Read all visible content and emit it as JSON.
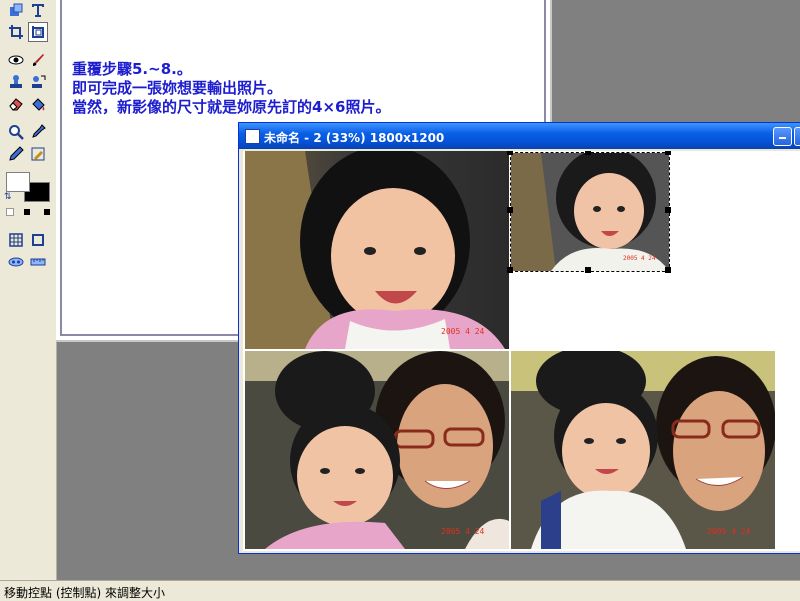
{
  "instructions": [
    "重覆步驟5.~8.。",
    "即可完成一張妳想要輸出照片。",
    "當然，新影像的尺寸就是妳原先訂的4×6照片。"
  ],
  "image_window": {
    "title": "未命名 - 2 (33%) 1800x1200",
    "controls": [
      "minimize",
      "maximize"
    ],
    "photos": [
      {
        "name": "baby-closeup",
        "date": "2005 4 24"
      },
      {
        "name": "baby-small-selected",
        "date": "2005 4 24"
      },
      {
        "name": "mother-and-baby-1",
        "date": "2005 4 24"
      },
      {
        "name": "mother-and-baby-2",
        "date": "2005 4 24"
      }
    ]
  },
  "tools": [
    "shape-icon",
    "text-icon",
    "crop-icon",
    "crop-grid-icon",
    "eye-icon",
    "brush-icon",
    "stamp-icon",
    "clone-icon",
    "eraser-icon",
    "fill-icon",
    "zoom-icon",
    "eyedropper-icon",
    "pencil-icon",
    "retouch-icon"
  ],
  "colors": {
    "foreground": "#ffffff",
    "background": "#000000",
    "title_bar": "#0553d9",
    "instruction_text": "#1d1dd0"
  },
  "status": {
    "message": "移動控點 (控制點) 來調整大小"
  }
}
